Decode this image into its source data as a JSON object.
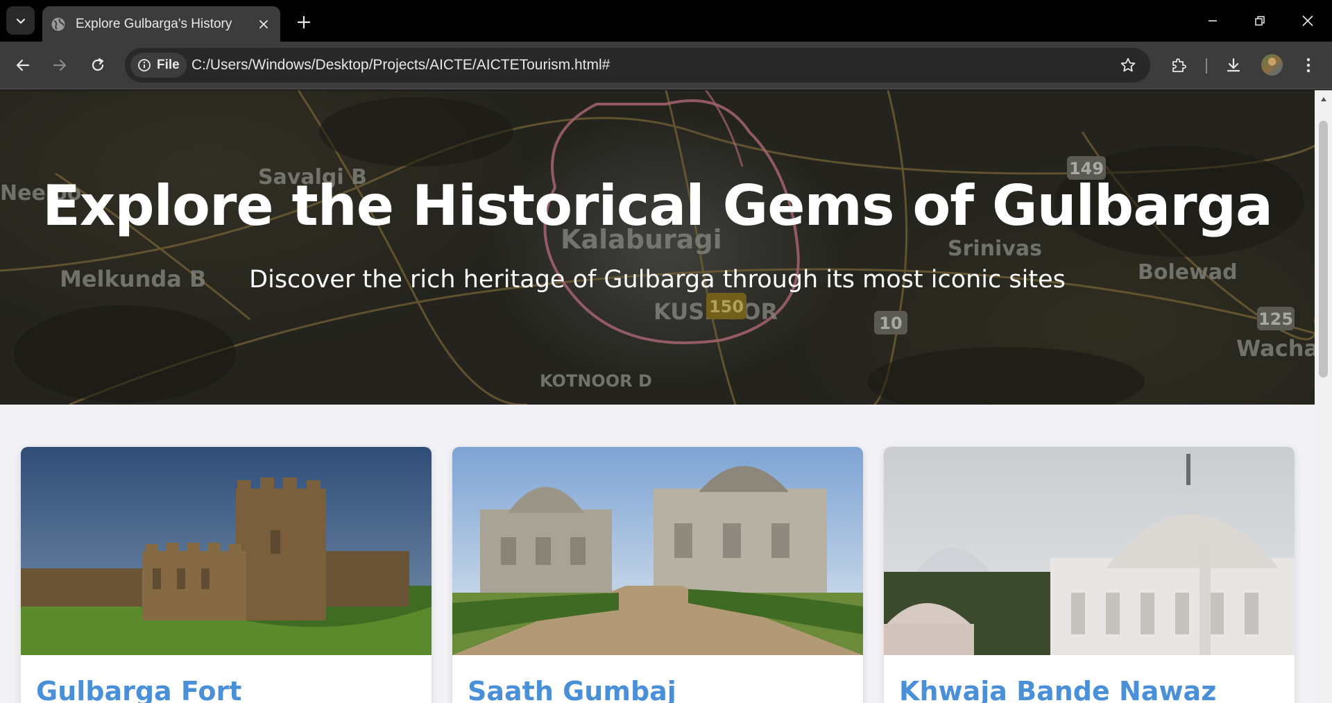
{
  "browser": {
    "tab": {
      "title": "Explore Gulbarga's History",
      "favicon": "globe-icon"
    },
    "toolbar": {
      "security_chip_label": "File",
      "url": "C:/Users/Windows/Desktop/Projects/AICTE/AICTETourism.html#"
    },
    "icons": {
      "tab_search": "chevron-down-icon",
      "tab_close": "close-icon",
      "new_tab": "plus-icon",
      "minimize": "minimize-icon",
      "restore": "restore-icon",
      "close_window": "close-icon",
      "back": "arrow-left-icon",
      "forward": "arrow-right-icon",
      "reload": "reload-icon",
      "info": "info-icon",
      "bookmark": "star-icon",
      "extensions": "puzzle-icon",
      "downloads": "download-icon",
      "menu": "kebab-icon"
    }
  },
  "page": {
    "hero": {
      "title": "Explore the Historical Gems of Gulbarga",
      "subtitle": "Discover the rich heritage of Gulbarga through its most iconic sites",
      "map_labels": [
        "Savalgi B",
        "Neeloo",
        "Kalaburagi",
        "Srinivas",
        "Bolewad",
        "Melkunda B",
        "KUSNOOR",
        "KOTNOOR D",
        "Wacha",
        "149",
        "10",
        "125",
        "150"
      ]
    },
    "cards": [
      {
        "title": "Gulbarga Fort"
      },
      {
        "title": "Saath Gumbaj"
      },
      {
        "title": "Khwaja Bande Nawaz"
      }
    ]
  },
  "colors": {
    "card_title": "#4a90d9",
    "page_background": "#f1f1f6",
    "toolbar": "#3c3c3c"
  }
}
